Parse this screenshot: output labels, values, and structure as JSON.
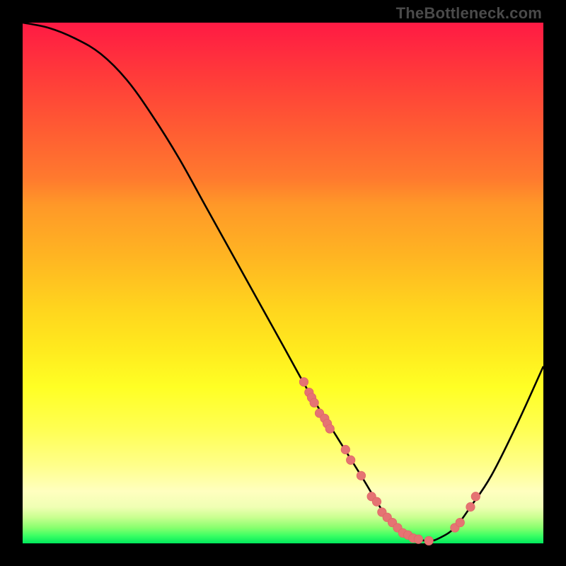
{
  "attribution": "TheBottleneck.com",
  "colors": {
    "curve_stroke": "#000000",
    "marker_fill": "#e57373",
    "marker_stroke": "#e06666"
  },
  "chart_data": {
    "type": "line",
    "title": "",
    "xlabel": "",
    "ylabel": "",
    "xlim": [
      0,
      100
    ],
    "ylim": [
      0,
      100
    ],
    "x": [
      0,
      5,
      10,
      15,
      20,
      25,
      30,
      35,
      40,
      45,
      50,
      55,
      60,
      65,
      68,
      70,
      72,
      75,
      78,
      80,
      83,
      86,
      90,
      95,
      100
    ],
    "values": [
      100,
      99,
      97,
      94,
      89,
      82,
      74,
      65,
      56,
      47,
      38,
      29,
      21,
      13,
      8,
      5,
      3,
      1,
      0.5,
      1,
      3,
      7,
      13,
      23,
      34
    ],
    "markers": {
      "x": [
        54,
        55,
        55.5,
        56,
        57,
        58,
        58.5,
        59,
        62,
        63,
        65,
        67,
        68,
        69,
        70,
        71,
        72,
        73,
        74,
        75,
        76,
        78,
        83,
        84,
        86,
        87
      ],
      "y": [
        31,
        29,
        28,
        27,
        25,
        24,
        23,
        22,
        18,
        16,
        13,
        9,
        8,
        6,
        5,
        4,
        3,
        2,
        1.6,
        1,
        0.8,
        0.5,
        3,
        4,
        7,
        9
      ]
    }
  }
}
